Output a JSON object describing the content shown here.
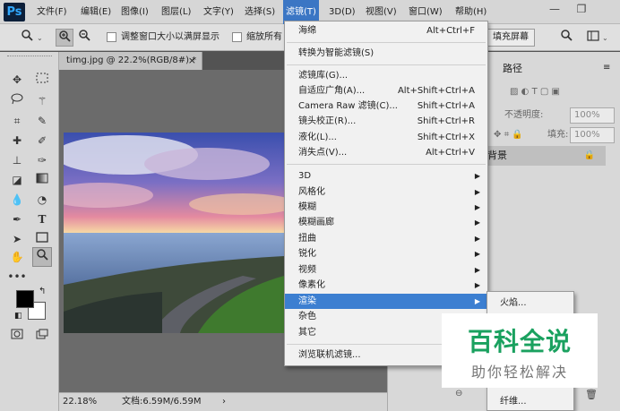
{
  "app": {
    "logo": "Ps"
  },
  "menubar": {
    "items": [
      {
        "label": "文件(F)"
      },
      {
        "label": "编辑(E)"
      },
      {
        "label": "图像(I)"
      },
      {
        "label": "图层(L)"
      },
      {
        "label": "文字(Y)"
      },
      {
        "label": "选择(S)"
      },
      {
        "label": "滤镜(T)"
      },
      {
        "label": "3D(D)"
      },
      {
        "label": "视图(V)"
      },
      {
        "label": "窗口(W)"
      },
      {
        "label": "帮助(H)"
      }
    ],
    "active": "滤镜(T)",
    "window_buttons": {
      "minimize": "—",
      "restore": "❐"
    }
  },
  "options_bar": {
    "resize_windows_label": "调整窗口大小以满屏显示",
    "zoom_all_label": "缩放所有窗",
    "fill_screen_label": "填充屏幕"
  },
  "document": {
    "tab_title": "timg.jpg @ 22.2%(RGB/8#) *",
    "zoom": "22.18%",
    "doc_size": "文档:6.59M/6.59M"
  },
  "panel": {
    "tab_paths": "路径",
    "opacity_label": "不透明度:",
    "opacity_value": "100%",
    "fill_label": "填充:",
    "fill_value": "100%",
    "layer_name": "背景"
  },
  "filter_menu": {
    "items": [
      {
        "label": "海绵",
        "shortcut": "Alt+Ctrl+F"
      },
      {
        "label": "转换为智能滤镜(S)",
        "shortcut": ""
      },
      {
        "label": "滤镜库(G)...",
        "shortcut": ""
      },
      {
        "label": "自适应广角(A)...",
        "shortcut": "Alt+Shift+Ctrl+A"
      },
      {
        "label": "Camera Raw 滤镜(C)...",
        "shortcut": "Shift+Ctrl+A"
      },
      {
        "label": "镜头校正(R)...",
        "shortcut": "Shift+Ctrl+R"
      },
      {
        "label": "液化(L)...",
        "shortcut": "Shift+Ctrl+X"
      },
      {
        "label": "消失点(V)...",
        "shortcut": "Alt+Ctrl+V"
      },
      {
        "label": "3D",
        "shortcut": ""
      },
      {
        "label": "风格化",
        "shortcut": ""
      },
      {
        "label": "模糊",
        "shortcut": ""
      },
      {
        "label": "模糊画廊",
        "shortcut": ""
      },
      {
        "label": "扭曲",
        "shortcut": ""
      },
      {
        "label": "锐化",
        "shortcut": ""
      },
      {
        "label": "视频",
        "shortcut": ""
      },
      {
        "label": "像素化",
        "shortcut": ""
      },
      {
        "label": "渲染",
        "shortcut": ""
      },
      {
        "label": "杂色",
        "shortcut": ""
      },
      {
        "label": "其它",
        "shortcut": ""
      },
      {
        "label": "浏览联机滤镜...",
        "shortcut": ""
      }
    ],
    "highlighted": "渲染"
  },
  "render_submenu": {
    "items": [
      {
        "label": "火焰..."
      },
      {
        "label": "纤维..."
      }
    ]
  },
  "watermark": {
    "title": "百科全说",
    "subtitle": "助你轻松解决"
  },
  "colors": {
    "menu_highlight": "#3c7fd1",
    "watermark_green": "#1aa15f"
  }
}
